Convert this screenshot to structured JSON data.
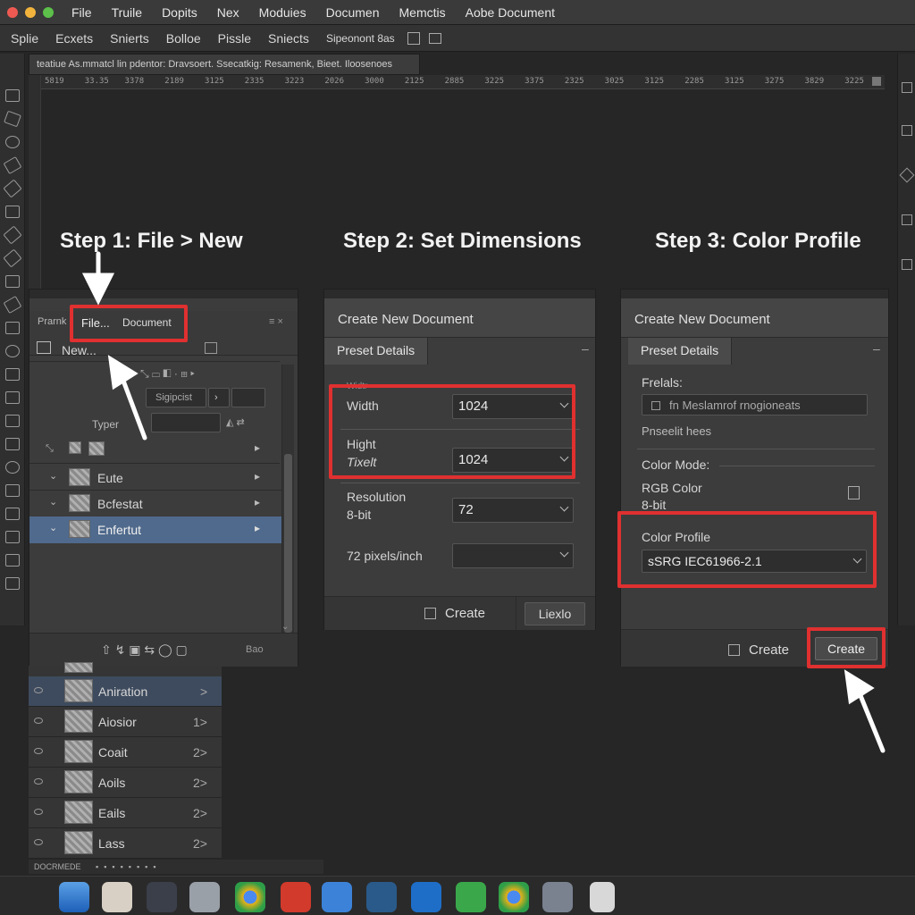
{
  "menubar": {
    "items": [
      "File",
      "Truile",
      "Dopits",
      "Nex",
      "Moduies",
      "Documen",
      "Memctis",
      "Aobe  Document"
    ]
  },
  "optionsbar": {
    "items": [
      "Splie",
      "Ecxets",
      "Snierts",
      "Bolloe",
      "Pissle",
      "Sniects",
      "Sipeonont 8as"
    ]
  },
  "doc_tab": {
    "title": "teatiue As.mmatcl lin pdentor: Dravsoert. Ssecatkig: Resamenk, Bieet. Iloosenoes"
  },
  "ruler": {
    "labels": [
      "5819",
      "33.35",
      "3378",
      "2189",
      "3125",
      "2335",
      "3223",
      "2026",
      "3000",
      "2125",
      "2885",
      "3225",
      "3375",
      "2325",
      "3025",
      "3125",
      "2285",
      "3125",
      "3275",
      "3829",
      "3225"
    ]
  },
  "steps": {
    "step1": "Step 1: File > New",
    "step2": "Step 2: Set Dimensions",
    "step3": "Step 3: Color Profile"
  },
  "panel1": {
    "tab_a": "Prarnk",
    "tab_b": "File...",
    "tab_c": "Document",
    "new_label": "New...",
    "sig_label": "Sigipcist",
    "type_label": "Typer",
    "layers": [
      "Eute",
      "Bcfestat",
      "Enfertut"
    ],
    "bottom_label": "Bao"
  },
  "panel2": {
    "title": "Create New Document",
    "tab": "Preset Details",
    "width_header": "Widtr",
    "width_label": "Width",
    "width_value": "1024",
    "height_label": "Hight",
    "height_sub": "Tixelt",
    "height_value": "1024",
    "resolution_label": "Resolution",
    "bit_label": "8-bit",
    "resolution_value": "72",
    "ppi_label": "72 pixels/inch",
    "create_label": "Create",
    "other_button": "Liexlo"
  },
  "panel3": {
    "title": "Create New Document",
    "tab": "Preset Details",
    "presets_label": "Frelals:",
    "presets_value": "fn Meslamrof rnogioneats",
    "preset_hint": "Pnseelit hees",
    "color_mode_label": "Color Mode:",
    "rgb_label": "RGB Color",
    "bit_label": "8-bit",
    "profile_label": "Color Profile",
    "profile_value": "sSRG IEC61966-2.1",
    "create_label": "Create",
    "create_button": "Create"
  },
  "layers_lower": [
    {
      "name": "Aniration",
      "num": ">"
    },
    {
      "name": "Aiosior",
      "num": "1>"
    },
    {
      "name": "Coait",
      "num": "2>"
    },
    {
      "name": "Aoils",
      "num": "2>"
    },
    {
      "name": "Eails",
      "num": "2>"
    },
    {
      "name": "Lass",
      "num": "2>"
    }
  ],
  "statusbar": {
    "label": "DOCRMEDE"
  },
  "colors": {
    "highlight": "#e03030",
    "selected_row": "#4f6a8c",
    "accent_blue": "#2f6db5"
  }
}
